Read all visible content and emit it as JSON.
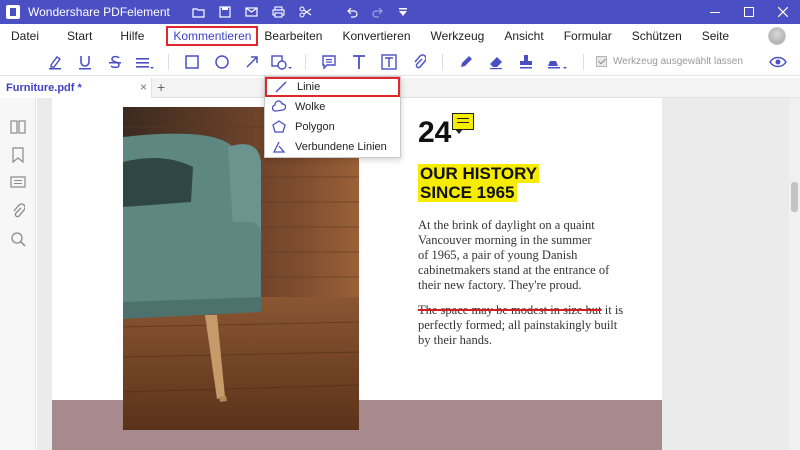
{
  "titlebar": {
    "app_title": "Wondershare PDFelement",
    "quick_access_icons": [
      "folder-icon",
      "save-icon",
      "mail-icon",
      "print-icon",
      "scissors-icon",
      "undo-icon",
      "redo-icon",
      "dropdown-icon"
    ],
    "window_controls": [
      "minimize-icon",
      "maximize-icon",
      "close-icon"
    ],
    "accent_color": "#4a4fc4"
  },
  "menu": {
    "items": [
      "Datei",
      "Start",
      "Hilfe",
      "Kommentieren",
      "Bearbeiten",
      "Konvertieren",
      "Werkzeug",
      "Ansicht",
      "Formular",
      "Schützen",
      "Seite"
    ],
    "active": "Kommentieren",
    "highlight_color": "#e0262d"
  },
  "toolbar": {
    "icons": [
      "highlight-pen-icon",
      "underline-icon",
      "strikethrough-icon",
      "text-lines-icon",
      "rectangle-icon",
      "circle-icon",
      "arrow-icon",
      "shapes-icon",
      "comment-icon",
      "text-icon",
      "textbox-icon",
      "attachment-icon",
      "pen-icon",
      "eraser-icon",
      "stamp-icon",
      "signature-icon",
      "eye-icon"
    ],
    "keep_tool_label": "Werkzeug ausgewählt lassen",
    "keep_tool_checked": true
  },
  "tabs": {
    "doc_tab": "Furniture.pdf *",
    "close": "×",
    "add": "+"
  },
  "dropdown": {
    "items": [
      {
        "label": "Linie",
        "icon": "line-icon"
      },
      {
        "label": "Wolke",
        "icon": "cloud-icon"
      },
      {
        "label": "Polygon",
        "icon": "polygon-icon"
      },
      {
        "label": "Verbundene Linien",
        "icon": "polyline-icon"
      }
    ],
    "selected": "Linie"
  },
  "left_panel": {
    "icons": [
      "thumbnail-icon",
      "bookmark-icon",
      "comments-panel-icon",
      "attachment-panel-icon",
      "search-icon"
    ]
  },
  "document": {
    "page_number": "24",
    "heading_line1": "OUR HISTORY",
    "heading_line2": "SINCE 1965",
    "para1_lines": [
      "At the brink of daylight on a quaint",
      "Vancouver morning in the summer",
      "of 1965, a pair of young Danish",
      "cabinetmakers stand at the entrance of",
      "their new factory. They're proud."
    ],
    "para2_struck": "The space may be modest in size but",
    "para2_rest": " it is",
    "para2_lines": [
      "perfectly formed; all painstakingly built",
      "by their hands."
    ],
    "highlight_color": "#f5ec00",
    "strike_color": "#d41f1f"
  }
}
